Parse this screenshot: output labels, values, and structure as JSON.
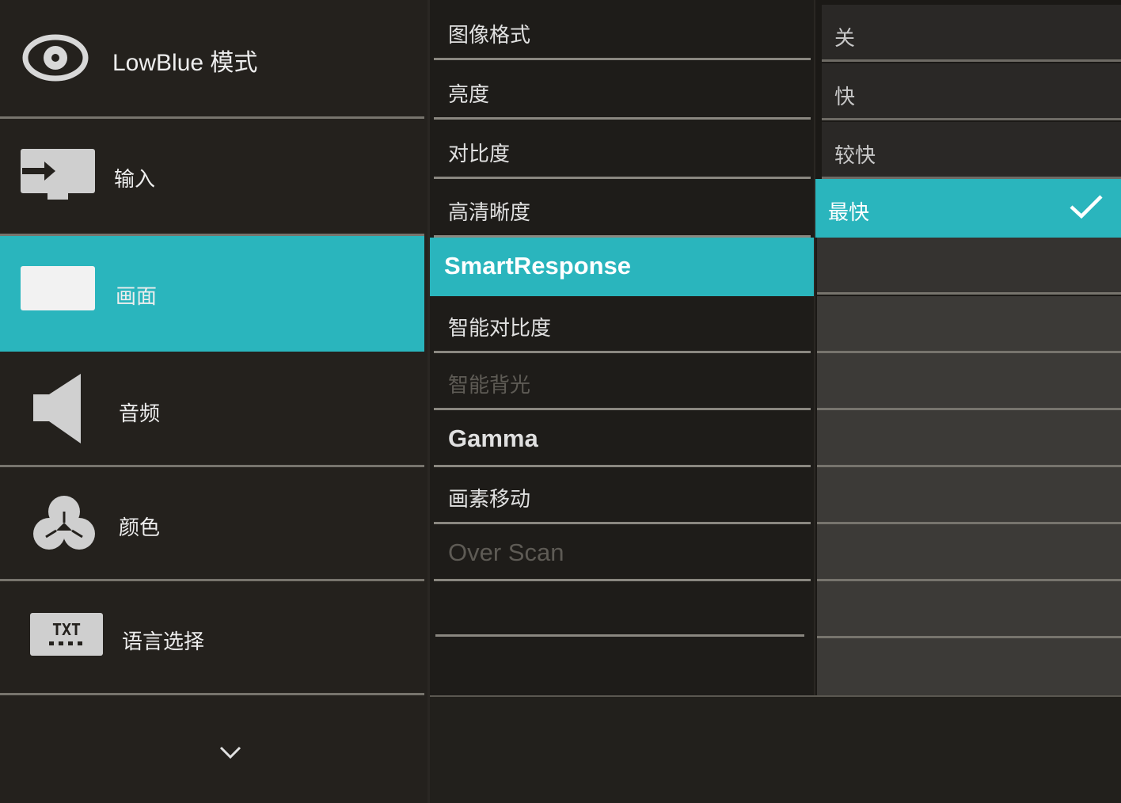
{
  "main_menu": {
    "lowblue": {
      "label": "LowBlue 模式",
      "icon": "eye-icon"
    },
    "items": [
      {
        "label": "输入",
        "icon": "input-monitor-icon"
      },
      {
        "label": "画面",
        "icon": "picture-screen-icon",
        "selected": true
      },
      {
        "label": "音频",
        "icon": "speaker-icon"
      },
      {
        "label": "颜色",
        "icon": "color-circles-icon"
      },
      {
        "label": "语言选择",
        "icon": "txt-language-icon"
      }
    ],
    "more_icon": "chevron-down-icon"
  },
  "picture_menu": {
    "items": [
      {
        "label": "图像格式"
      },
      {
        "label": "亮度"
      },
      {
        "label": "对比度"
      },
      {
        "label": "高清晰度"
      },
      {
        "label": "SmartResponse",
        "selected": true
      },
      {
        "label": "智能对比度"
      },
      {
        "label": "智能背光",
        "disabled": true
      },
      {
        "label": "Gamma"
      },
      {
        "label": "画素移动"
      },
      {
        "label": "Over Scan",
        "disabled": true
      }
    ]
  },
  "smartresponse_options": {
    "items": [
      {
        "label": "关"
      },
      {
        "label": "快"
      },
      {
        "label": "较快"
      },
      {
        "label": "最快",
        "selected": true
      }
    ],
    "check_icon": "checkmark-icon"
  },
  "colors": {
    "accent": "#2ab5bd",
    "panel_bg": "#24211d",
    "separator": "#77746d"
  }
}
